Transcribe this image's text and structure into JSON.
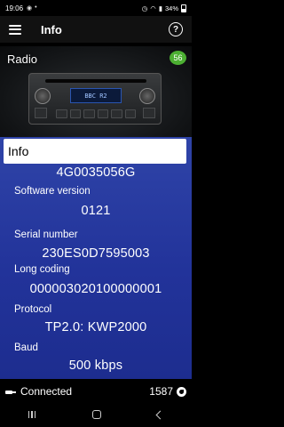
{
  "status_bar": {
    "time": "19:06",
    "battery": "34%"
  },
  "app_bar": {
    "title": "Info"
  },
  "hero": {
    "label": "Radio",
    "badge": "56",
    "radio_display": "BBC R2"
  },
  "info": {
    "header": "Info",
    "part_number": "4G0035056G",
    "fields": [
      {
        "label": "Software version",
        "value": "0121"
      },
      {
        "label": "Serial number",
        "value": "230ES0D7595003"
      },
      {
        "label": "Long coding",
        "value": "000003020100000001"
      },
      {
        "label": "Protocol",
        "value": "TP2.0: KWP2000"
      },
      {
        "label": "Baud",
        "value": "500 kbps"
      }
    ]
  },
  "bottom_bar": {
    "status": "Connected",
    "counter": "1587"
  }
}
